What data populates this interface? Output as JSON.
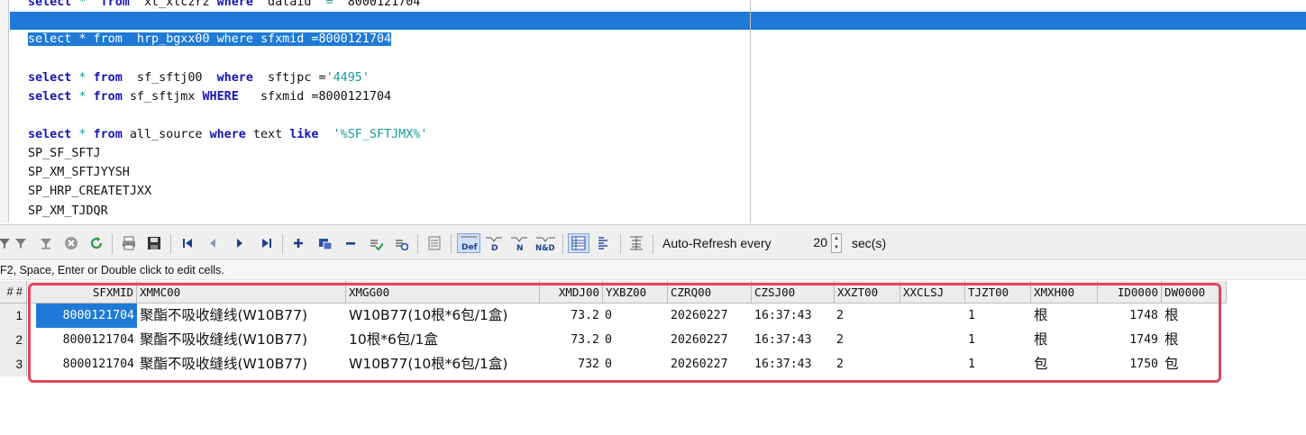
{
  "editor": {
    "lines": [
      [
        {
          "t": "select",
          "c": "kw"
        },
        {
          "t": " * ",
          "c": "str"
        },
        {
          "t": " from",
          "c": "kw"
        },
        {
          "t": "  xt_xtczrz "
        },
        {
          "t": "where",
          "c": "kw"
        },
        {
          "t": "  dataid  "
        },
        {
          "t": "=",
          "c": "str"
        },
        {
          "t": "  8000121704"
        }
      ],
      [
        {
          "t": "select * from  hrp_bgxx00 where sfxmid =8000121704",
          "c": "sel"
        }
      ],
      [
        {
          "t": "select",
          "c": "kw"
        },
        {
          "t": " * ",
          "c": "str"
        },
        {
          "t": "from",
          "c": "kw"
        },
        {
          "t": "  sf_sftj00  "
        },
        {
          "t": "where",
          "c": "kw"
        },
        {
          "t": "  sftjpc ="
        },
        {
          "t": "'4495'",
          "c": "str"
        }
      ],
      [
        {
          "t": "select",
          "c": "kw"
        },
        {
          "t": " * ",
          "c": "str"
        },
        {
          "t": "from",
          "c": "kw"
        },
        {
          "t": " sf_sftjmx "
        },
        {
          "t": "WHERE",
          "c": "kw"
        },
        {
          "t": "   sfxmid =8000121704"
        }
      ],
      [
        {
          "t": "select",
          "c": "kw"
        },
        {
          "t": " * ",
          "c": "str"
        },
        {
          "t": "from",
          "c": "kw"
        },
        {
          "t": " all_source "
        },
        {
          "t": "where",
          "c": "kw"
        },
        {
          "t": " text "
        },
        {
          "t": "like",
          "c": "kw"
        },
        {
          "t": "  "
        },
        {
          "t": "'%SF_SFTJMX%'",
          "c": "str"
        }
      ],
      [
        {
          "t": "SP_SF_SFTJ"
        }
      ],
      [
        {
          "t": "SP_XM_SFTJYYSH"
        }
      ],
      [
        {
          "t": "SP_HRP_CREATETJXX"
        }
      ],
      [
        {
          "t": "SP_XM_TJDQR"
        }
      ]
    ]
  },
  "toolbar": {
    "auto_refresh_label": "Auto-Refresh every",
    "interval": "20",
    "unit_label": "sec(s)",
    "active_tool_icon": "def-icon"
  },
  "hint": "F2, Space, Enter or Double click to edit cells.",
  "grid": {
    "row_num_header": "# #",
    "columns": [
      "SFXMID",
      "XMMC00",
      "XMGG00",
      "XMDJ00",
      "YXBZ00",
      "CZRQ00",
      "CZSJ00",
      "XXZT00",
      "XXCLSJ",
      "TJZT00",
      "XMXH00",
      "ID0000",
      "DW0000"
    ],
    "rows": [
      {
        "num": "1",
        "cells": [
          "8000121704",
          "聚酯不吸收缝线(W10B77)",
          "W10B77(10根*6包/1盒)",
          "73.2",
          "0",
          "20260227",
          "16:37:43",
          "2",
          "",
          "1",
          "根",
          "1748",
          "根"
        ]
      },
      {
        "num": "2",
        "cells": [
          "8000121704",
          "聚酯不吸收缝线(W10B77)",
          "10根*6包/1盒",
          "73.2",
          "0",
          "20260227",
          "16:37:43",
          "2",
          "",
          "1",
          "根",
          "1749",
          "根"
        ]
      },
      {
        "num": "3",
        "cells": [
          "8000121704",
          "聚酯不吸收缝线(W10B77)",
          "W10B77(10根*6包/1盒)",
          "732",
          "0",
          "20260227",
          "16:37:43",
          "2",
          "",
          "1",
          "包",
          "1750",
          "包"
        ]
      }
    ],
    "selected_cell": "row 1 SFXMID"
  },
  "colors": {
    "selection": "#1e7ad6",
    "keyword": "#1515b5",
    "string": "#1a9a9a",
    "highlight_box": "#e24660"
  }
}
